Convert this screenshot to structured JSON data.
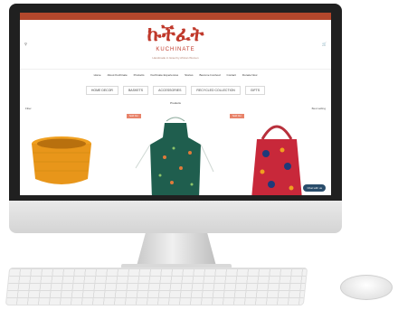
{
  "site": {
    "logo_text": "ኩችፈት",
    "brand_name": "KUCHINATE",
    "tagline": "Handmade in Israel by African Women"
  },
  "header": {
    "left_icon": "search-icon",
    "right_icon": "cart-icon"
  },
  "nav": {
    "items": [
      "Home",
      "About Kuchinate",
      "Products",
      "Kuchinate Experiences",
      "Stories",
      "Become Involved",
      "Contact",
      "Donate Now"
    ]
  },
  "categories": [
    "HOME DECOR",
    "BASKETS",
    "ACCESSORIES",
    "RECYCLED COLLECTION",
    "GIFTS"
  ],
  "products": {
    "title": "Products",
    "filter_left": "Filter",
    "filter_right": "Best selling",
    "items": [
      {
        "badge": "Sold Out",
        "name": "Crochet basket"
      },
      {
        "badge": "Sold Out",
        "name": "Apron"
      },
      {
        "badge": "Sold Out",
        "name": "Tote bag"
      }
    ]
  },
  "chat": {
    "label": "Chat with us"
  },
  "colors": {
    "brand": "#c0392b",
    "topbar": "#b3472c",
    "badge": "#e8836a"
  }
}
